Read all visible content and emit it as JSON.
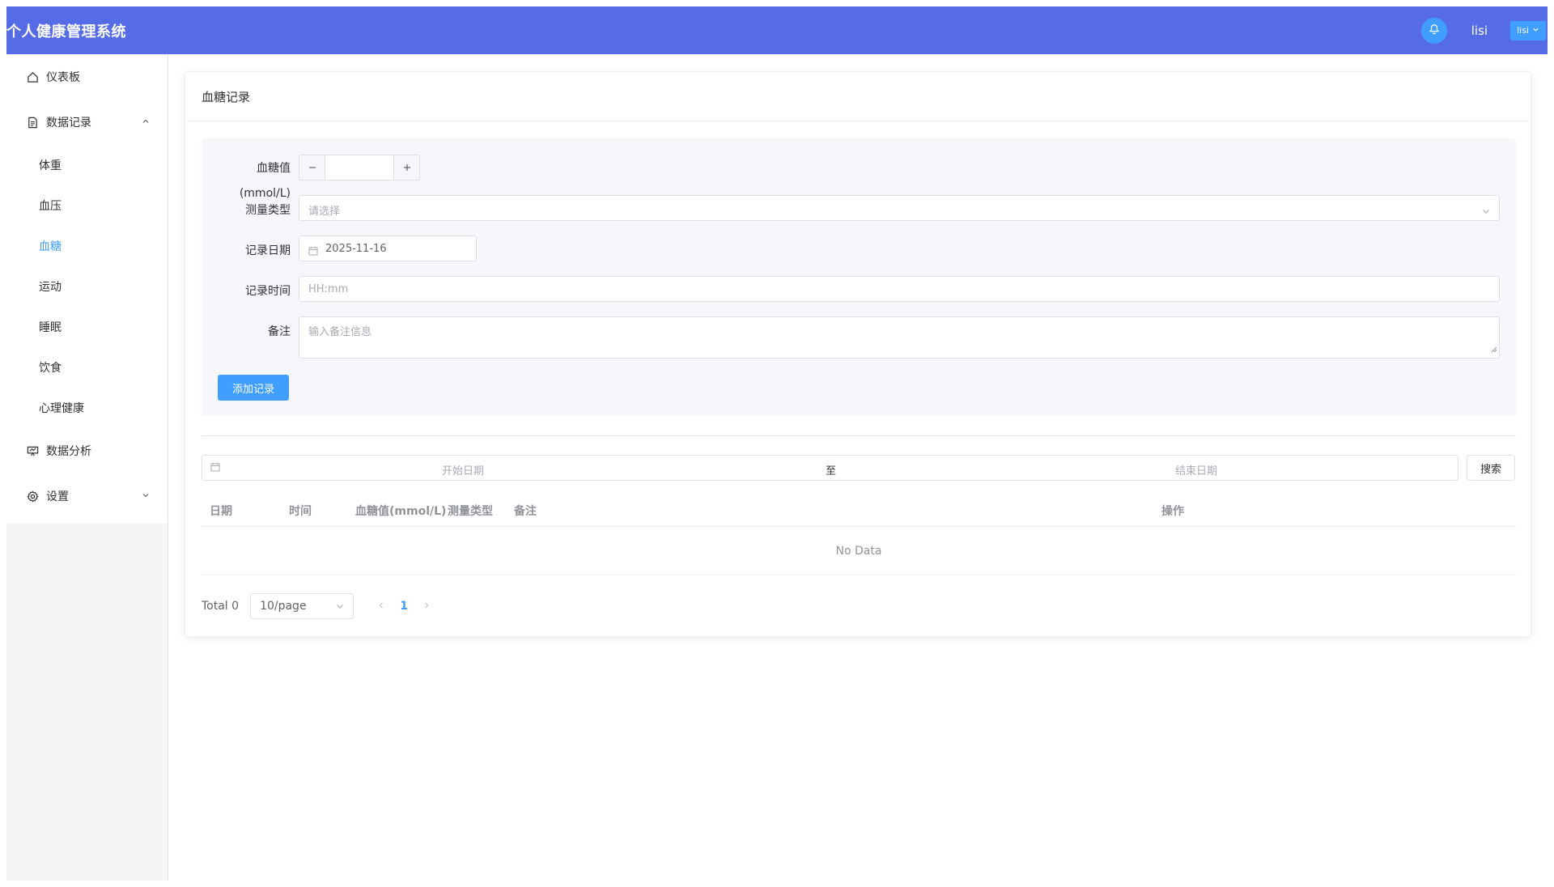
{
  "app": {
    "title": "个人健康管理系统"
  },
  "header": {
    "username": "lisi",
    "dropdown_label": "lisi"
  },
  "sidebar": {
    "dashboard": "仪表板",
    "data_records": "数据记录",
    "sub_items": [
      "体重",
      "血压",
      "血糖",
      "运动",
      "睡眠",
      "饮食",
      "心理健康"
    ],
    "active_sub_item": "血糖",
    "data_analysis": "数据分析",
    "settings": "设置"
  },
  "page": {
    "title": "血糖记录"
  },
  "form": {
    "glucose_label": "血糖值",
    "unit_label": "(mmol/L)",
    "glucose_value": "",
    "measure_type_label": "测量类型",
    "measure_type_placeholder": "请选择",
    "date_label": "记录日期",
    "date_value": "2025-11-16",
    "time_label": "记录时间",
    "time_placeholder": "HH:mm",
    "note_label": "备注",
    "note_placeholder": "输入备注信息",
    "submit_label": "添加记录"
  },
  "filter": {
    "start_placeholder": "开始日期",
    "separator": "至",
    "end_placeholder": "结束日期",
    "search_label": "搜索"
  },
  "table": {
    "columns": [
      "日期",
      "时间",
      "血糖值(mmol/L)",
      "测量类型",
      "备注",
      "操作"
    ],
    "empty_text": "No Data"
  },
  "pagination": {
    "total_text": "Total 0",
    "page_size": "10/page",
    "current_page": "1"
  },
  "colors": {
    "header_bg": "#556ce6",
    "primary": "#409eff"
  }
}
